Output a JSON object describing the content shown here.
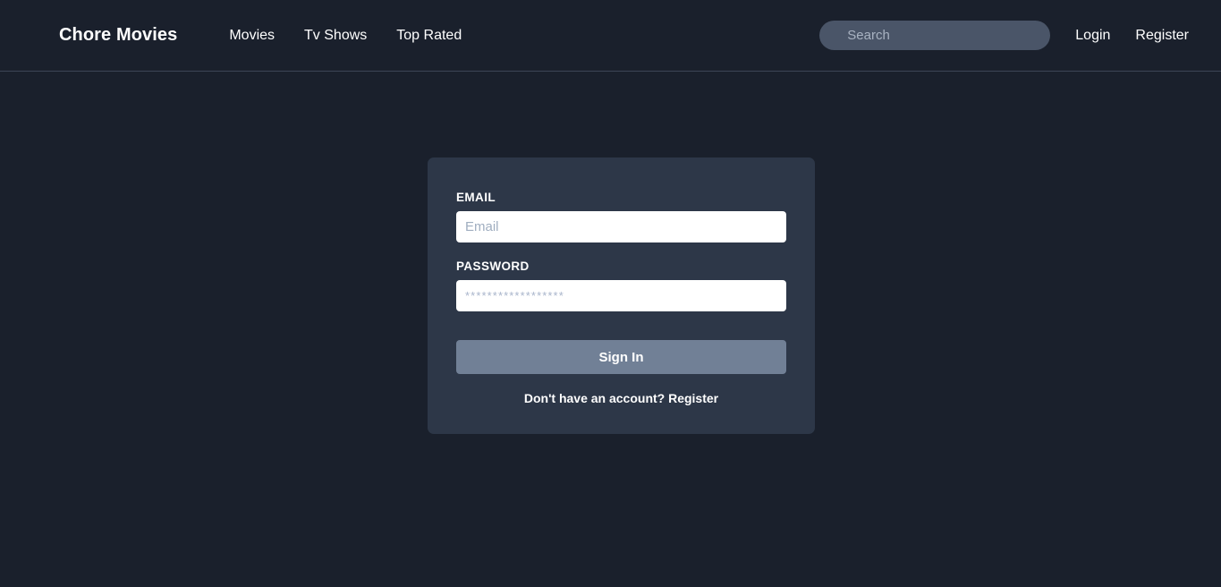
{
  "navbar": {
    "brand": "Chore Movies",
    "links": [
      {
        "label": "Movies"
      },
      {
        "label": "Tv Shows"
      },
      {
        "label": "Top Rated"
      }
    ],
    "search": {
      "placeholder": "Search",
      "value": ""
    },
    "auth_links": [
      {
        "label": "Login"
      },
      {
        "label": "Register"
      }
    ]
  },
  "login_card": {
    "email": {
      "label": "EMAIL",
      "placeholder": "Email",
      "value": ""
    },
    "password": {
      "label": "PASSWORD",
      "placeholder": "******************",
      "value": ""
    },
    "submit_label": "Sign In",
    "register_hint": "Don't have an account? Register"
  },
  "colors": {
    "page_background": "#1a202c",
    "card_background": "#2d3748",
    "button": "#718096",
    "search_background": "#4a5568",
    "text": "#ffffff",
    "placeholder": "#a0aec0",
    "divider": "#3d4556"
  }
}
